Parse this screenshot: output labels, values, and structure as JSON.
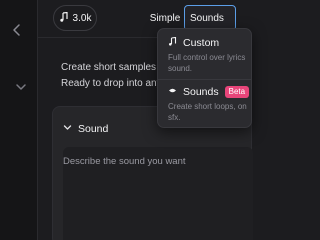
{
  "topbar": {
    "credits": "3.0k",
    "mode_simple": "Simple",
    "mode_sounds": "Sounds"
  },
  "intro": {
    "line1": "Create short samples —",
    "line2": "Ready to drop into anyth"
  },
  "card": {
    "title": "Sound",
    "placeholder": "Describe the sound you want"
  },
  "menu": {
    "custom": {
      "label": "Custom",
      "desc_line1": "Full control over lyrics",
      "desc_line2": "sound."
    },
    "sounds": {
      "label": "Sounds",
      "badge": "Beta",
      "desc_line1": "Create short loops, on",
      "desc_line2": "sfx."
    }
  },
  "icons": {
    "rail_back": "chevron-left-icon",
    "rail_expand": "chevron-down-icon",
    "credits": "music-note-icon",
    "card_toggle": "chevron-down-icon",
    "custom": "music-note-icon",
    "sounds": "waveform-icon"
  },
  "colors": {
    "background": "#1c1c1f",
    "accent_border": "#5b9ee8",
    "beta_badge": "#e8457a"
  }
}
